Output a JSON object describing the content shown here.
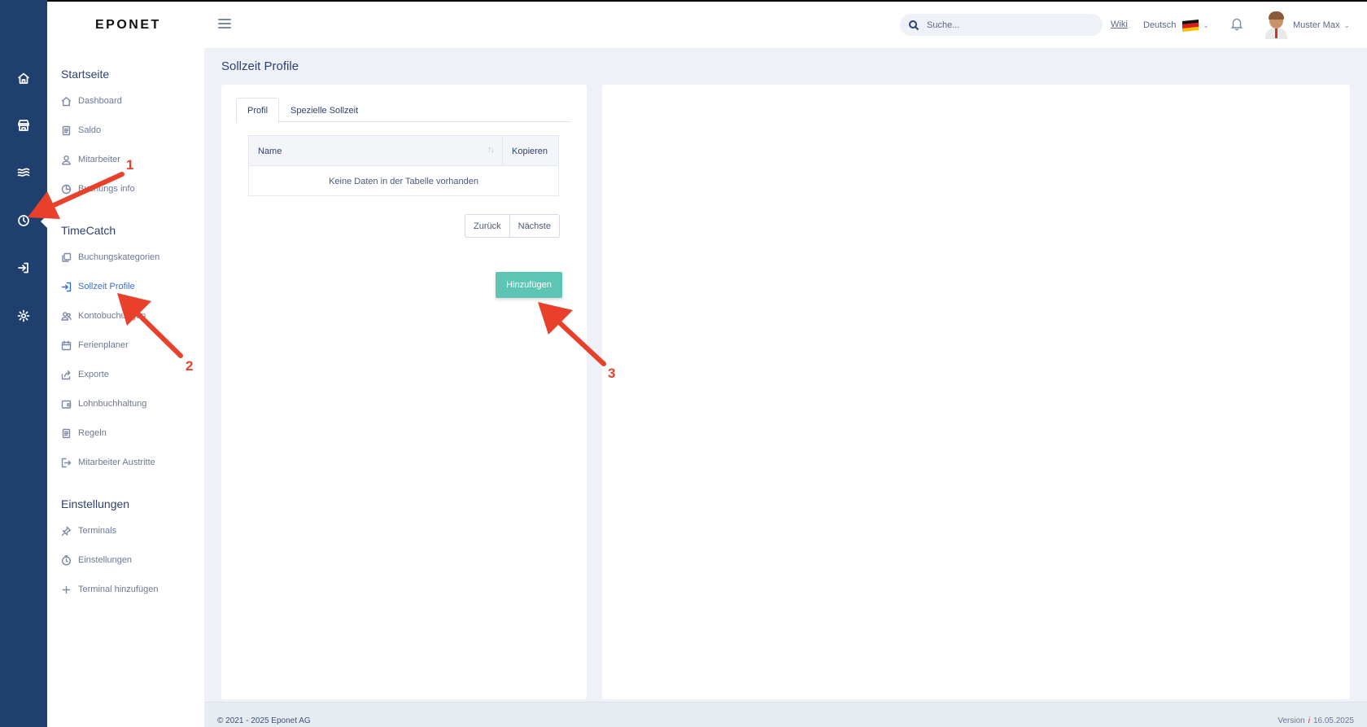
{
  "app": {
    "logo": "EPONET"
  },
  "header": {
    "search_placeholder": "Suche...",
    "wiki": "Wiki",
    "language": "Deutsch",
    "user_name": "Muster Max"
  },
  "rail": {
    "icons": [
      "home-icon",
      "store-icon",
      "waves-icon",
      "clock-icon",
      "login-icon",
      "gear-icon"
    ]
  },
  "sidebar": {
    "sections": [
      {
        "title": "Startseite",
        "items": [
          {
            "label": "Dashboard",
            "icon": "home-icon"
          },
          {
            "label": "Saldo",
            "icon": "document-icon"
          },
          {
            "label": "Mitarbeiter",
            "icon": "user-icon"
          },
          {
            "label": "Buchungs info",
            "icon": "chart-icon"
          }
        ]
      },
      {
        "title": "TimeCatch",
        "items": [
          {
            "label": "Buchungskategorien",
            "icon": "copy-icon"
          },
          {
            "label": "Sollzeit Profile",
            "icon": "login-icon",
            "active": true
          },
          {
            "label": "Kontobuchungen",
            "icon": "users-icon"
          },
          {
            "label": "Ferienplaner",
            "icon": "calendar-icon"
          },
          {
            "label": "Exporte",
            "icon": "share-icon"
          },
          {
            "label": "Lohnbuchhaltung",
            "icon": "wallet-icon"
          },
          {
            "label": "Regeln",
            "icon": "document-icon"
          },
          {
            "label": "Mitarbeiter Austritte",
            "icon": "logout-icon"
          }
        ]
      },
      {
        "title": "Einstellungen",
        "items": [
          {
            "label": "Terminals",
            "icon": "pin-icon"
          },
          {
            "label": "Einstellungen",
            "icon": "timer-icon"
          },
          {
            "label": "Terminal hinzufügen",
            "icon": "plus-icon"
          }
        ]
      }
    ]
  },
  "main": {
    "page_title": "Sollzeit Profile",
    "tabs": [
      {
        "label": "Profil",
        "active": true
      },
      {
        "label": "Spezielle Sollzeit",
        "active": false
      }
    ],
    "table": {
      "columns": [
        "Name",
        "Kopieren"
      ],
      "empty_message": "Keine Daten in der Tabelle vorhanden"
    },
    "pager": {
      "prev": "Zurück",
      "next": "Nächste"
    },
    "add_button": "Hinzufügen"
  },
  "footer": {
    "copyright": "© 2021 - 2025 Eponet AG",
    "version_label": "Version",
    "version_date": "16.05.2025"
  },
  "annotations": [
    "1",
    "2",
    "3"
  ],
  "colors": {
    "rail": "#1f3f6e",
    "accent": "#3c6fc9",
    "add_button": "#5ec4b4",
    "annotation": "#e8402a"
  }
}
